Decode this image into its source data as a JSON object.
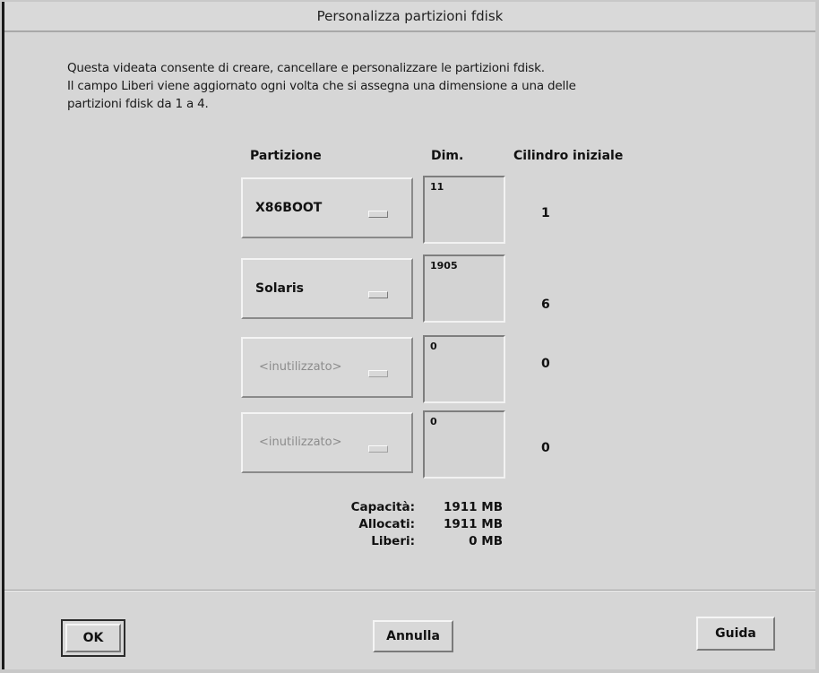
{
  "window": {
    "title": "Personalizza partizioni fdisk"
  },
  "intro": {
    "line1": "Questa videata consente di creare, cancellare e personalizzare le partizioni fdisk.",
    "line2": "Il campo Liberi viene aggiornato ogni volta che si assegna una dimensione a una delle",
    "line3": "partizioni fdisk da 1 a 4."
  },
  "columns": {
    "partition": "Partizione",
    "size": "Dim.",
    "start_cylinder": "Cilindro iniziale"
  },
  "partitions": [
    {
      "type": "X86BOOT",
      "size": "11",
      "start_cylinder": "1",
      "enabled": true
    },
    {
      "type": "Solaris",
      "size": "1905",
      "start_cylinder": "6",
      "enabled": true
    },
    {
      "type": "<inutilizzato>",
      "size": "0",
      "start_cylinder": "0",
      "enabled": false
    },
    {
      "type": "<inutilizzato>",
      "size": "0",
      "start_cylinder": "0",
      "enabled": false
    }
  ],
  "summary": {
    "capacity_label": "Capacità:",
    "capacity_value": "1911 MB",
    "allocated_label": "Allocati:",
    "allocated_value": "1911 MB",
    "free_label": "Liberi:",
    "free_value": "0 MB"
  },
  "buttons": {
    "ok": "OK",
    "cancel": "Annulla",
    "help": "Guida"
  },
  "colors": {
    "background": "#d6d6d6",
    "disabled_text": "#8c8c8c"
  }
}
